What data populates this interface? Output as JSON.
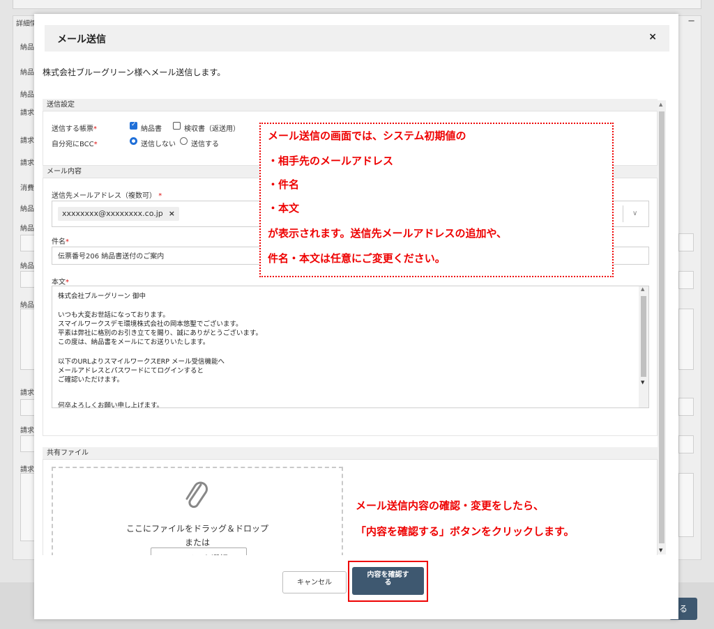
{
  "background": {
    "panel_title": "詳細情",
    "collapse_symbol": "−",
    "labels": [
      "納品",
      "納品",
      "納品",
      "請求",
      "請求",
      "請求",
      "消費",
      "納品",
      "納品",
      "納品",
      "納品",
      "請求",
      "請求",
      "請求"
    ],
    "dark_button_text": "る"
  },
  "modal": {
    "title": "メール送信",
    "close": "×",
    "intro": "株式会社ブルーグリーン様へメール送信します。"
  },
  "send_settings": {
    "heading": "送信設定",
    "doc_label": "送信する帳票",
    "doc_options": [
      {
        "label": "納品書",
        "checked": true
      },
      {
        "label": "検収書（返送用）",
        "checked": false
      }
    ],
    "bcc_label": "自分宛にBCC",
    "bcc_options": [
      {
        "label": "送信しない",
        "selected": true
      },
      {
        "label": "送信する",
        "selected": false
      }
    ]
  },
  "mail_content": {
    "heading": "メール内容",
    "to_label": "送信先メールアドレス（複数可）",
    "to_chip": "xxxxxxxx@xxxxxxxx.co.jp",
    "chip_remove": "×",
    "caret": "∨",
    "subject_label": "件名",
    "subject_value": "伝票番号206 納品書送付のご案内",
    "body_label": "本文",
    "body_lines": [
      "株式会社ブルーグリーン 御中",
      "",
      "いつも大変お世話になっております。",
      "スマイルワークスデモ環境株式会社の岡本悠聖でございます。",
      "平素は弊社に格別のお引き立てを賜り、誠にありがとうございます。",
      "この度は、納品書をメールにてお送りいたします。",
      "",
      "以下のURLよりスマイルワークスERP メール受信機能へ",
      "メールアドレスとパスワードにてログインすると",
      "ご確認いただけます。",
      "",
      "何卒よろしくお願い申し上げます。"
    ]
  },
  "shared_files": {
    "heading": "共有ファイル",
    "clip_icon": "paperclip-icon",
    "drop_text": "ここにファイルをドラッグ＆ドロップ",
    "or_text": "または",
    "select_button": "ファイルを選択"
  },
  "buttons": {
    "cancel": "キャンセル",
    "confirm_line1": "内容を確認す",
    "confirm_line2": "る"
  },
  "annotations": {
    "box_lines": [
      "メール送信の画面では、システム初期値の",
      "・相手先のメールアドレス",
      "・件名",
      "・本文",
      "が表示されます。送信先メールアドレスの追加や、",
      "件名・本文は任意にご変更ください。"
    ],
    "bottom_lines": [
      "メール送信内容の確認・変更をしたら、",
      "「内容を確認する」ボタンをクリックします。"
    ]
  },
  "colors": {
    "accent": "#3e5870",
    "annotation": "#e00000",
    "checkbox": "#1f6fd8"
  }
}
